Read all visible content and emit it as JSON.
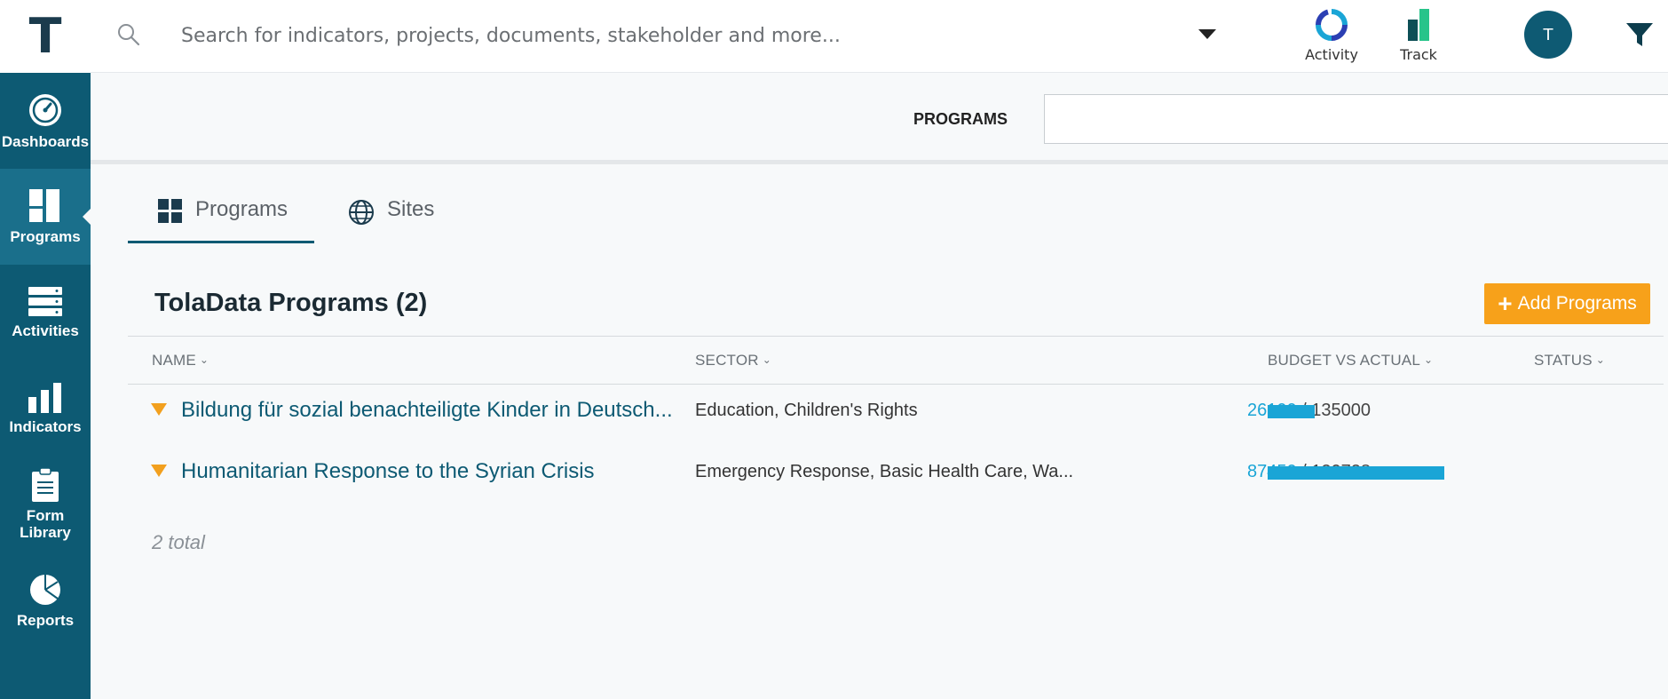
{
  "topbar": {
    "logo": "T",
    "search_placeholder": "Search for indicators, projects, documents, stakeholder and more...",
    "activity_label": "Activity",
    "track_label": "Track",
    "avatar_initial": "T"
  },
  "sidebar": {
    "items": [
      {
        "label": "Dashboards",
        "icon": "speedometer-icon"
      },
      {
        "label": "Programs",
        "icon": "programs-grid-icon",
        "active": true
      },
      {
        "label": "Activities",
        "icon": "server-stack-icon"
      },
      {
        "label": "Indicators",
        "icon": "bar-chart-icon"
      },
      {
        "label": "Form Library",
        "icon": "clipboard-icon"
      },
      {
        "label": "Reports",
        "icon": "pie-chart-icon"
      }
    ]
  },
  "subheader": {
    "label": "PROGRAMS"
  },
  "tabs": [
    {
      "label": "Programs",
      "icon": "grid-icon",
      "active": true
    },
    {
      "label": "Sites",
      "icon": "globe-icon"
    }
  ],
  "main": {
    "title": "TolaData Programs (2)",
    "add_button": "Add Programs",
    "columns": {
      "name": "NAME",
      "sector": "SECTOR",
      "budget": "BUDGET VS ACTUAL",
      "status": "STATUS"
    },
    "rows": [
      {
        "name": "Bildung für sozial benachteiligte Kinder in Deutsch...",
        "sector": "Education, Children's Rights",
        "actual": "26100",
        "separator": "/ 135000",
        "progress": 0.193
      },
      {
        "name": "Humanitarian Response to the Syrian Crisis",
        "sector": "Emergency Response, Basic Health Care, Wa...",
        "actual": "87450",
        "separator": "/ 120728",
        "progress": 0.724
      }
    ],
    "total": "2 total"
  },
  "colors": {
    "sidebar": "#0d5a73",
    "accent": "#1aa5d6",
    "orange": "#f7a11a"
  }
}
